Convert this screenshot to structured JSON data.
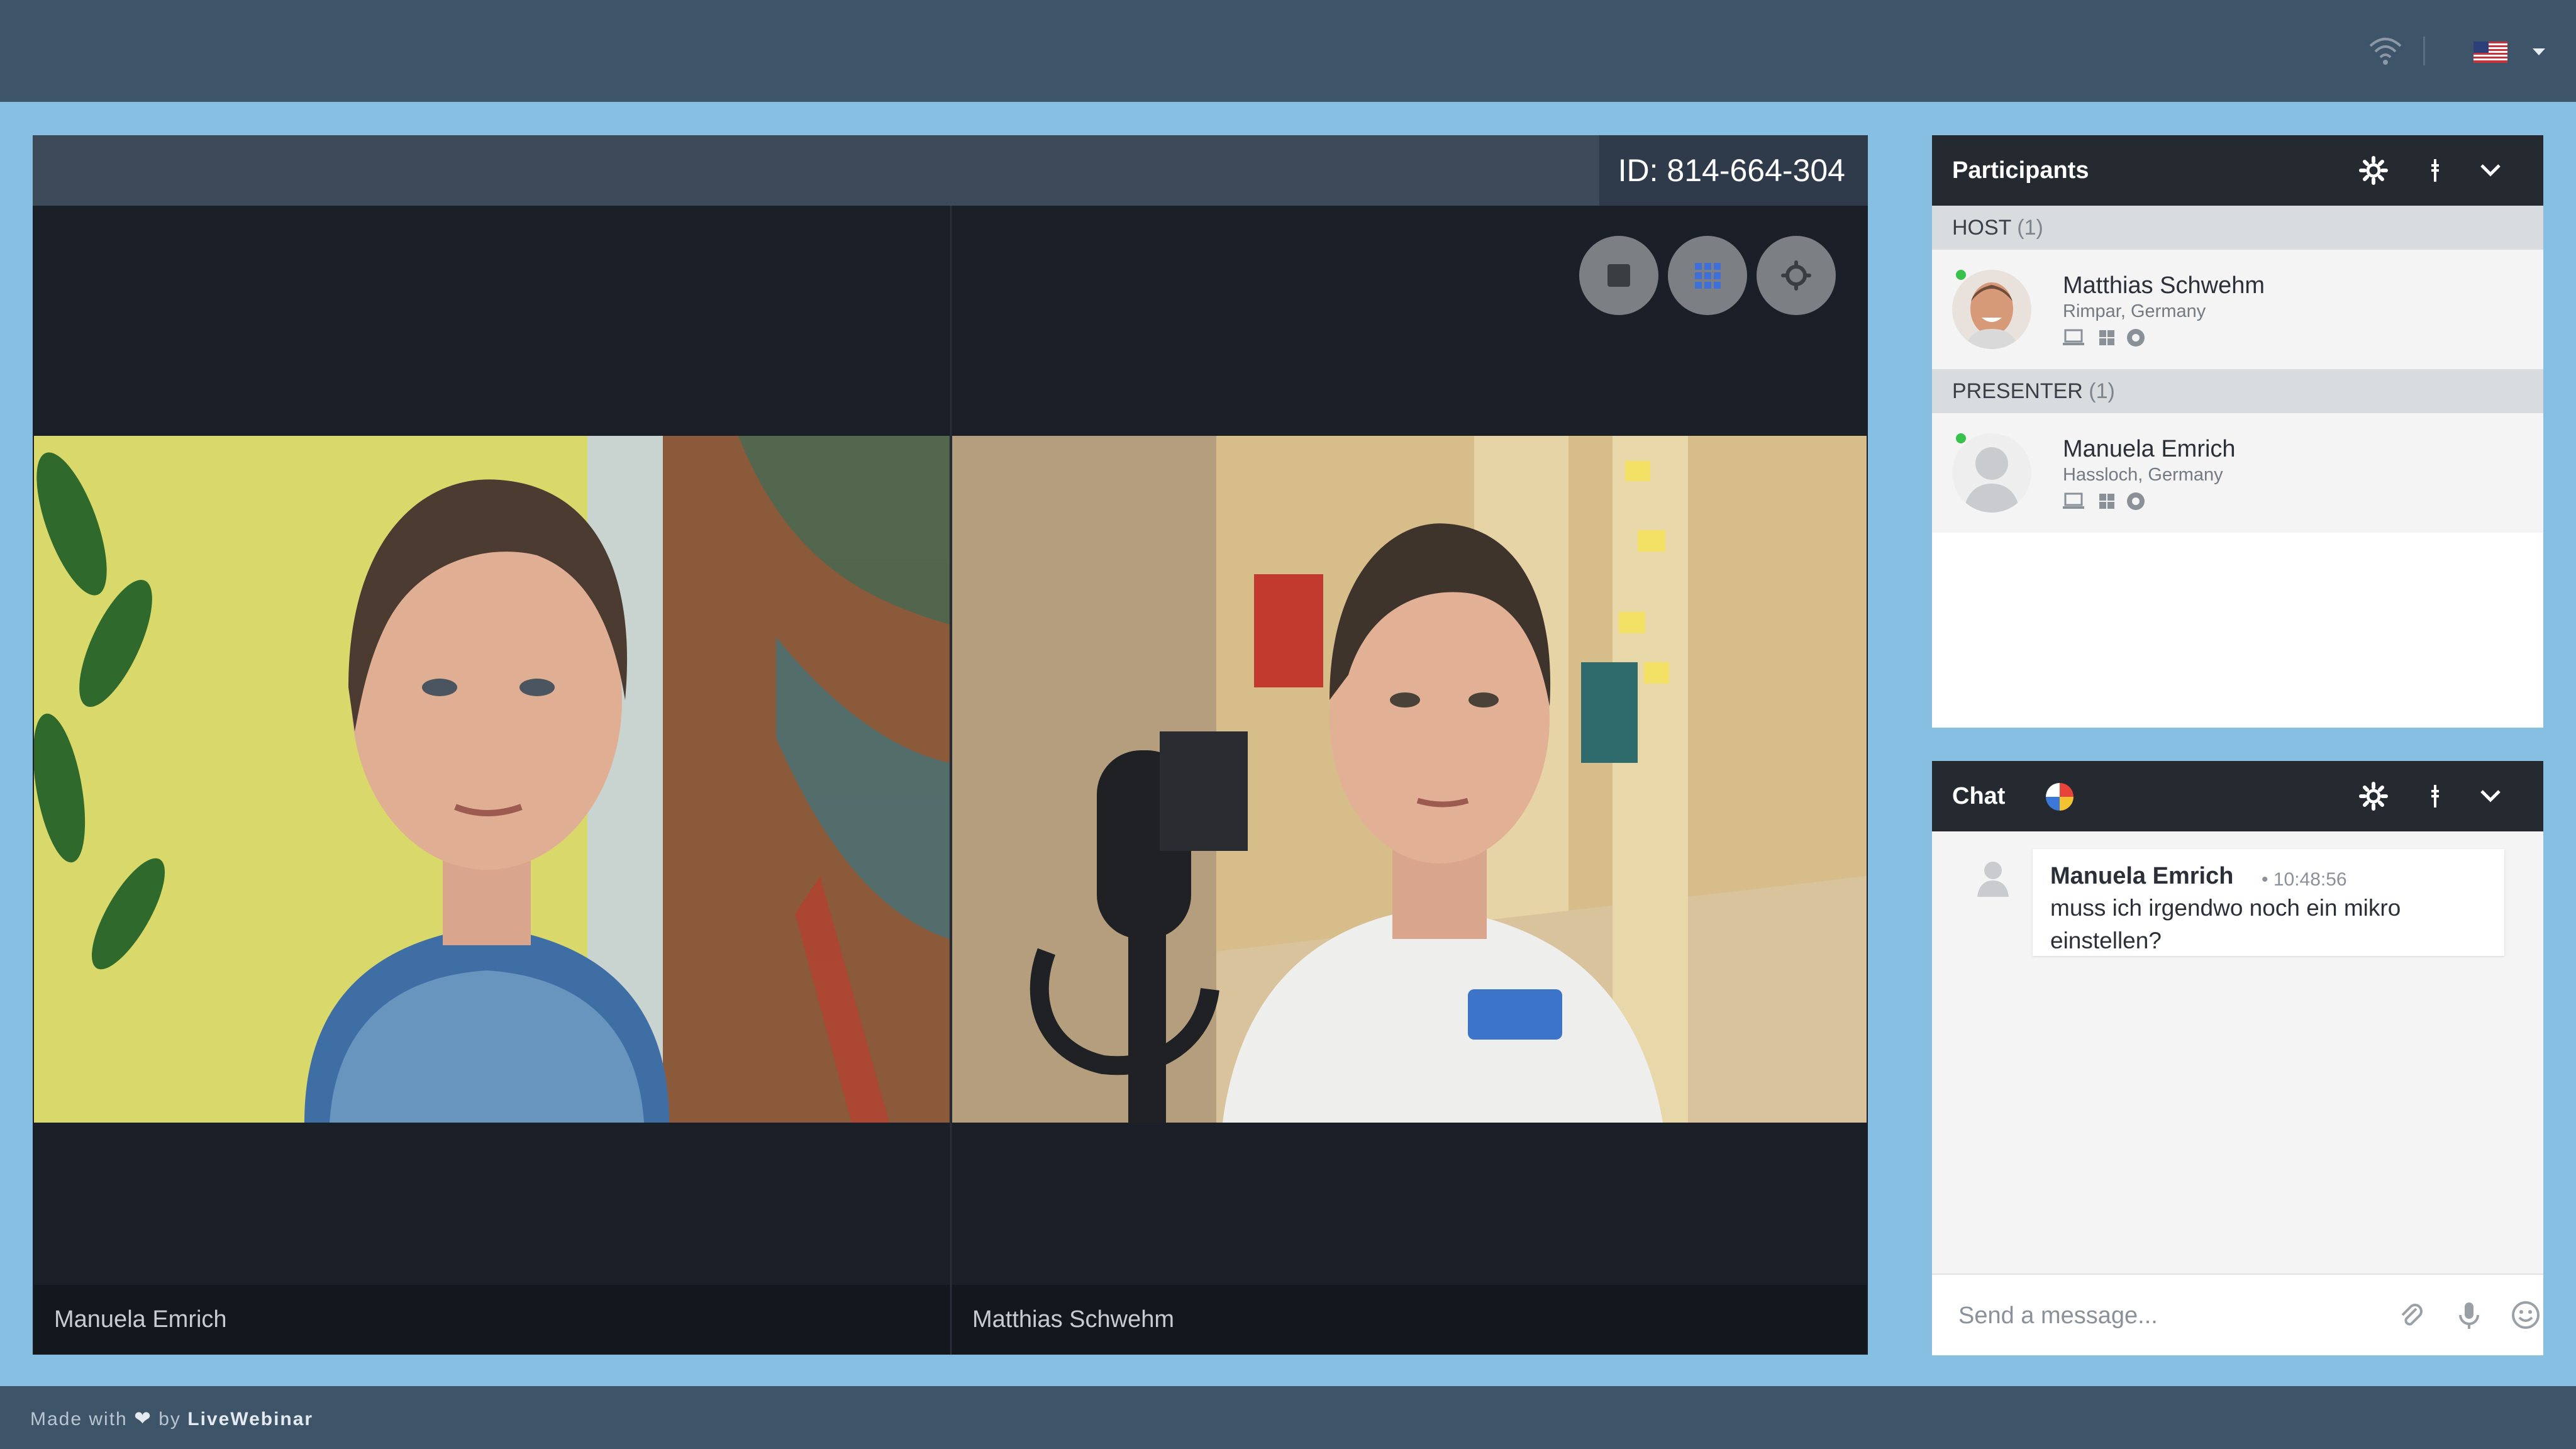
{
  "top_bar": {
    "wifi_icon": "wifi-icon",
    "language_flag": "us-flag-icon",
    "language_menu_icon": "caret-down-icon"
  },
  "stage": {
    "meeting_id": "ID: 814-664-304",
    "controls": [
      {
        "name": "stop-icon"
      },
      {
        "name": "grid-layout-icon",
        "color": "#3f6fd8"
      },
      {
        "name": "settings-icon"
      }
    ],
    "videos": [
      {
        "name": "Manuela Emrich"
      },
      {
        "name": "Matthias Schwehm"
      }
    ]
  },
  "participants": {
    "title": "Participants",
    "groups": [
      {
        "label": "HOST",
        "count": "(1)",
        "members": [
          {
            "name": "Matthias Schwehm",
            "location": "Rimpar, Germany",
            "status": "online"
          }
        ]
      },
      {
        "label": "PRESENTER",
        "count": "(1)",
        "members": [
          {
            "name": "Manuela Emrich",
            "location": "Hassloch, Germany",
            "status": "online"
          }
        ]
      }
    ],
    "header_icons": [
      "gear-icon",
      "drag-handle-icon",
      "chevron-down-icon"
    ]
  },
  "chat": {
    "title": "Chat",
    "messages": [
      {
        "author": "Manuela Emrich",
        "time": "10:48:56",
        "text": "muss ich irgendwo noch ein mikro einstellen?"
      }
    ],
    "input_placeholder": "Send a message...",
    "input_icons": [
      "attachment-icon",
      "microphone-icon",
      "emoji-icon"
    ]
  },
  "footer": {
    "made_with": "Made with",
    "by": "by",
    "brand": "LiveWebinar"
  },
  "colors": {
    "page_background": "#87bfe3",
    "bar_background": "#3e5469",
    "online_dot": "#36c24b"
  }
}
